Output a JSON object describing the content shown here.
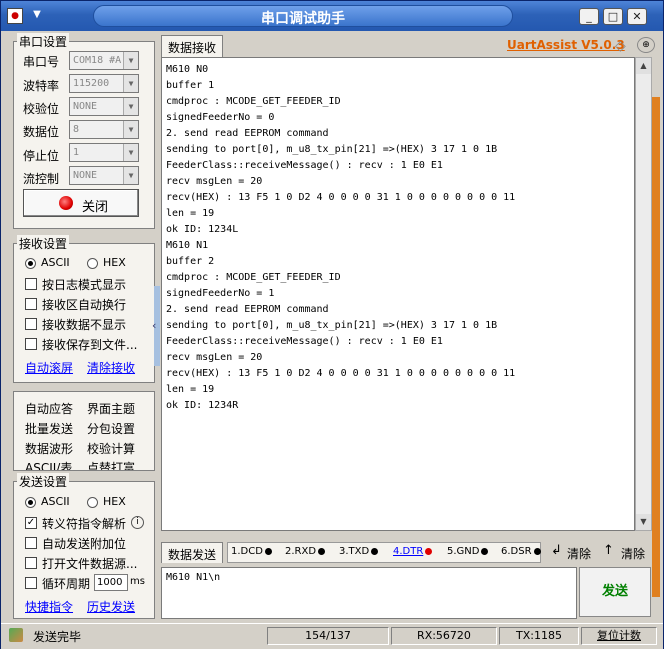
{
  "window": {
    "title": "串口调试助手",
    "brand": "UartAssist V5.0.3"
  },
  "serial_settings": {
    "title": "串口设置",
    "port_label": "串口号",
    "port_value": "COM18 #A",
    "baud_label": "波特率",
    "baud_value": "115200",
    "parity_label": "校验位",
    "parity_value": "NONE",
    "databits_label": "数据位",
    "databits_value": "8",
    "stopbits_label": "停止位",
    "stopbits_value": "1",
    "flow_label": "流控制",
    "flow_value": "NONE",
    "close_button": "关闭"
  },
  "recv_settings": {
    "title": "接收设置",
    "ascii": "ASCII",
    "hex": "HEX",
    "log_mode": "按日志模式显示",
    "auto_wrap": "接收区自动换行",
    "hide_recv": "接收数据不显示",
    "save_file": "接收保存到文件...",
    "auto_scroll": "自动滚屏",
    "clear_recv": "清除接收"
  },
  "tools": {
    "auto_reply": "自动应答",
    "ui_theme": "界面主题",
    "batch_send": "批量发送",
    "packet_setting": "分包设置",
    "data_wave": "数据波形",
    "checksum": "校验计算",
    "ascii_table": "ASCII/表",
    "clock_punch": "点替打富"
  },
  "send_settings": {
    "title": "发送设置",
    "ascii": "ASCII",
    "hex": "HEX",
    "escape_parse": "转义符指令解析",
    "auto_append": "自动发送附加位",
    "open_file": "打开文件数据源...",
    "cycle": "循环周期",
    "cycle_value": "1000",
    "cycle_unit": "ms",
    "quick_cmd": "快捷指令",
    "history": "历史发送"
  },
  "recv_tab": "数据接收",
  "recv_lines": [
    "M610 N0",
    "buffer 1",
    "cmdproc : MCODE_GET_FEEDER_ID",
    "signedFeederNo = 0",
    "2. send read EEPROM command",
    "sending to port[0], m_u8_tx_pin[21] =>(HEX) 3 17 1 0 1B",
    "FeederClass::receiveMessage() : recv : 1 E0 E1",
    "recv msgLen = 20",
    "recv(HEX) : 13 F5 1 0 D2 4 0 0 0 0 31 1 0 0 0 0 0 0 0 0 11",
    "len = 19",
    "ok ID: 1234L",
    "M610 N1",
    "buffer 2",
    "cmdproc : MCODE_GET_FEEDER_ID",
    "signedFeederNo = 1",
    "2. send read EEPROM command",
    "sending to port[0], m_u8_tx_pin[21] =>(HEX) 3 17 1 0 1B",
    "FeederClass::receiveMessage() : recv : 1 E0 E1",
    "recv msgLen = 20",
    "recv(HEX) : 13 F5 1 0 D2 4 0 0 0 0 31 1 0 0 0 0 0 0 0 0 11",
    "len = 19",
    "ok ID: 1234R"
  ],
  "send_bar": {
    "tab": "数据发送",
    "pins": [
      "1.DCD",
      "2.RXD",
      "3.TXD",
      "4.DTR",
      "5.GND",
      "6.DSR"
    ],
    "clear1": "清除",
    "clear2": "清除",
    "send_text": "M610 N1\\n",
    "send_button": "发送"
  },
  "status": {
    "message": "发送完毕",
    "counter": "154/137",
    "rx": "RX:56720",
    "tx": "TX:1185",
    "reset": "复位计数"
  },
  "colors": {
    "title_blue": "#2d62b8",
    "brand_orange": "#e06000",
    "send_green": "#008000",
    "led_red": "#e00000"
  }
}
